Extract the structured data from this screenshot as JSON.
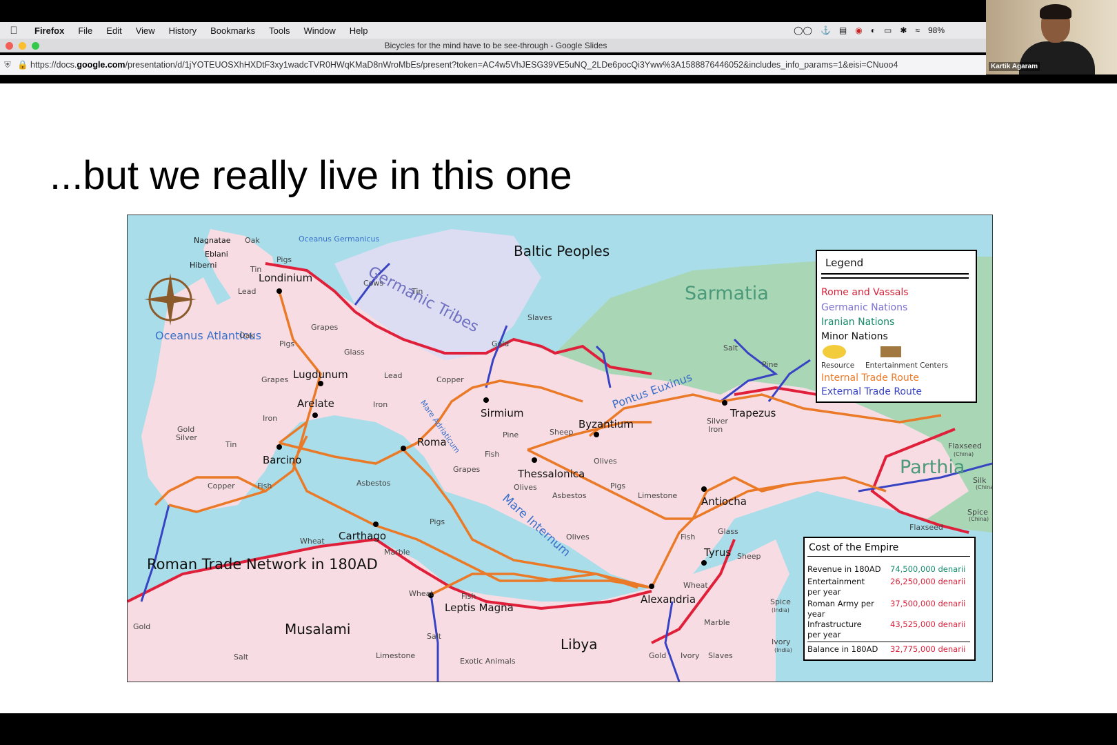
{
  "menubar": {
    "apple": "",
    "app": "Firefox",
    "items": [
      "File",
      "Edit",
      "View",
      "History",
      "Bookmarks",
      "Tools",
      "Window",
      "Help"
    ],
    "battery": "98%"
  },
  "window": {
    "title": "Bicycles for the mind have to be see-through - Google Slides"
  },
  "urlbar": {
    "url_prefix": "https://docs.",
    "url_domain": "google.com",
    "url_rest": "/presentation/d/1jYOTEUOSXhHXDtF3xy1wadcTVR0HWqKMaD8nWroMbEs/present?token=AC4w5VhJESG39VE5uNQ_2LDe6pocQi3Yww%3A1588876446052&includes_info_params=1&eisi=CNuoo4"
  },
  "webcam": {
    "name": "Kartik Agaram"
  },
  "slide": {
    "title": "...but we really live in this one"
  },
  "map": {
    "caption": "Roman Trade Network in 180AD",
    "regions": [
      "Baltic Peoples",
      "Sarmatia",
      "Parthia",
      "Musalami",
      "Libya"
    ],
    "tribes": "Germanic Tribes",
    "seas": [
      "Oceanus Atlanticus",
      "Oceanus Germanicus",
      "Pontus Euxinus",
      "Mare Internum",
      "Mare Adriaticum"
    ],
    "cities": [
      "Londinium",
      "Lugdunum",
      "Arelate",
      "Barcino",
      "Roma",
      "Sirmium",
      "Byzantium",
      "Thessalonica",
      "Trapezus",
      "Antiocha",
      "Tyrus",
      "Alexandria",
      "Carthago",
      "Leptis Magna"
    ],
    "places": [
      "Nagnatae",
      "Eblani",
      "Hiberni"
    ],
    "resources": [
      "Oak",
      "Tin",
      "Pigs",
      "Cows",
      "Tin",
      "Lead",
      "Oak",
      "Grapes",
      "Pigs",
      "Glass",
      "Slaves",
      "Gold",
      "Grapes",
      "Lead",
      "Copper",
      "Iron",
      "Iron",
      "Gold",
      "Silver",
      "Tin",
      "Pine",
      "Sheep",
      "Grapes",
      "Fish",
      "Olives",
      "Pigs",
      "Copper",
      "Fish",
      "Asbestos",
      "Olives",
      "Asbestos",
      "Limestone",
      "Silver",
      "Iron",
      "Salt",
      "Pine",
      "Wheat",
      "Pigs",
      "Olives",
      "Fish",
      "Glass",
      "Sheep",
      "Wheat",
      "Marble",
      "Wheat",
      "Fish",
      "Salt",
      "Gold",
      "Salt",
      "Limestone",
      "Exotic Animals",
      "Gold",
      "Ivory",
      "Slaves",
      "Marble",
      "Spice",
      "Ivory",
      "Flaxseed",
      "Silk",
      "Spice",
      "Flaxseed"
    ],
    "resource_notes": {
      "india": "(India)",
      "china": "(China)"
    }
  },
  "legend": {
    "title": "Legend",
    "entries": [
      {
        "label": "Rome and Vassals",
        "color": "#d9213a"
      },
      {
        "label": "Germanic Nations",
        "color": "#7b6fd1"
      },
      {
        "label": "Iranian Nations",
        "color": "#178a6a"
      },
      {
        "label": "Minor Nations",
        "color": "#111111"
      }
    ],
    "resource_label": "Resource",
    "entertainment_label": "Entertainment Centers",
    "internal_route": {
      "label": "Internal Trade Route",
      "color": "#ea7a28"
    },
    "external_route": {
      "label": "External Trade Route",
      "color": "#3843c4"
    }
  },
  "cost": {
    "title": "Cost of the Empire",
    "rows": [
      {
        "label": "Revenue in 180AD",
        "value": "74,500,000 denarii",
        "color": "#178a6a"
      },
      {
        "label": "Entertainment per year",
        "value": "26,250,000 denarii",
        "color": "#d9213a"
      },
      {
        "label": "Roman Army per year",
        "value": "37,500,000 denarii",
        "color": "#d9213a"
      },
      {
        "label": "Infrastructure per year",
        "value": "43,525,000 denarii",
        "color": "#d9213a"
      }
    ],
    "balance": {
      "label": "Balance in 180AD",
      "value": "32,775,000 denarii",
      "color": "#d9213a"
    }
  }
}
